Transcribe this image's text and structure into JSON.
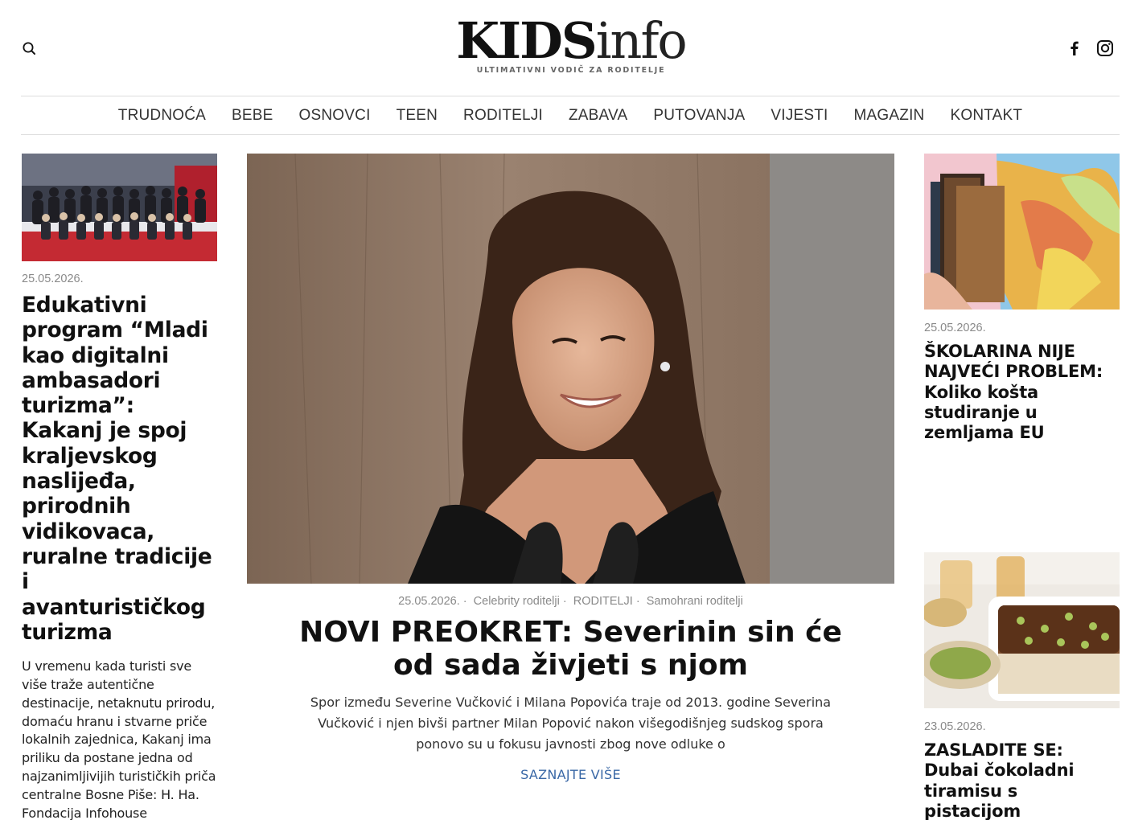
{
  "header": {
    "logo_main": "KIDS",
    "logo_sub": "info",
    "logo_tagline": "ULTIMATIVNI VODIČ ZA RODITELJE",
    "icons": [
      "search-icon",
      "facebook-icon",
      "instagram-icon"
    ]
  },
  "nav": {
    "items": [
      {
        "label": "TRUDNOĆA"
      },
      {
        "label": "BEBE"
      },
      {
        "label": "OSNOVCI"
      },
      {
        "label": "TEEN"
      },
      {
        "label": "RODITELJI"
      },
      {
        "label": "ZABAVA"
      },
      {
        "label": "PUTOVANJA"
      },
      {
        "label": "VIJESTI"
      },
      {
        "label": "MAGAZIN"
      },
      {
        "label": "KONTAKT"
      }
    ]
  },
  "left_article": {
    "date": "25.05.2026.",
    "title": "Edukativni program “Mladi kao digitalni ambasadori turizma”: Kakanj je spoj kraljevskog naslijeđa, prirodnih vidikovaca, ruralne tradicije i avanturističkog turizma",
    "excerpt": "U vremenu kada turisti sve više traže autentične destinacije, netaknutu prirodu, domaću hranu i stvarne priče lokalnih zajednica, Kakanj ima priliku da postane jedna od najzanimljivijih turističkih priča centralne Bosne Piše: H. Ha. Fondacija Infohouse"
  },
  "featured_article": {
    "date": "25.05.2026.",
    "categories": [
      "Celebrity roditelji",
      "RODITELJI",
      "Samohrani roditelji"
    ],
    "title": "NOVI PREOKRET: Severinin sin će od sada živjeti s njom",
    "excerpt": "Spor između Severine Vučković i Milana Popovića traje od 2013. godine Severina Vučković i njen bivši partner Milan Popović nakon višegodišnjeg sudskog spora ponovo su u fokusu javnosti zbog nove odluke o",
    "more_label": "SAZNAJTE VIŠE"
  },
  "right_articles": [
    {
      "date": "25.05.2026.",
      "title": "ŠKOLARINA NIJE NAJVEĆI PROBLEM: Koliko košta studiranje u zemljama EU"
    },
    {
      "date": "23.05.2026.",
      "title": "ZASLADITE SE: Dubai čokoladni tiramisu s pistacijom"
    }
  ],
  "colors": {
    "link": "#3a68a6",
    "meta": "#8a8a8a",
    "divider": "#dddddd",
    "text": "#111111"
  }
}
